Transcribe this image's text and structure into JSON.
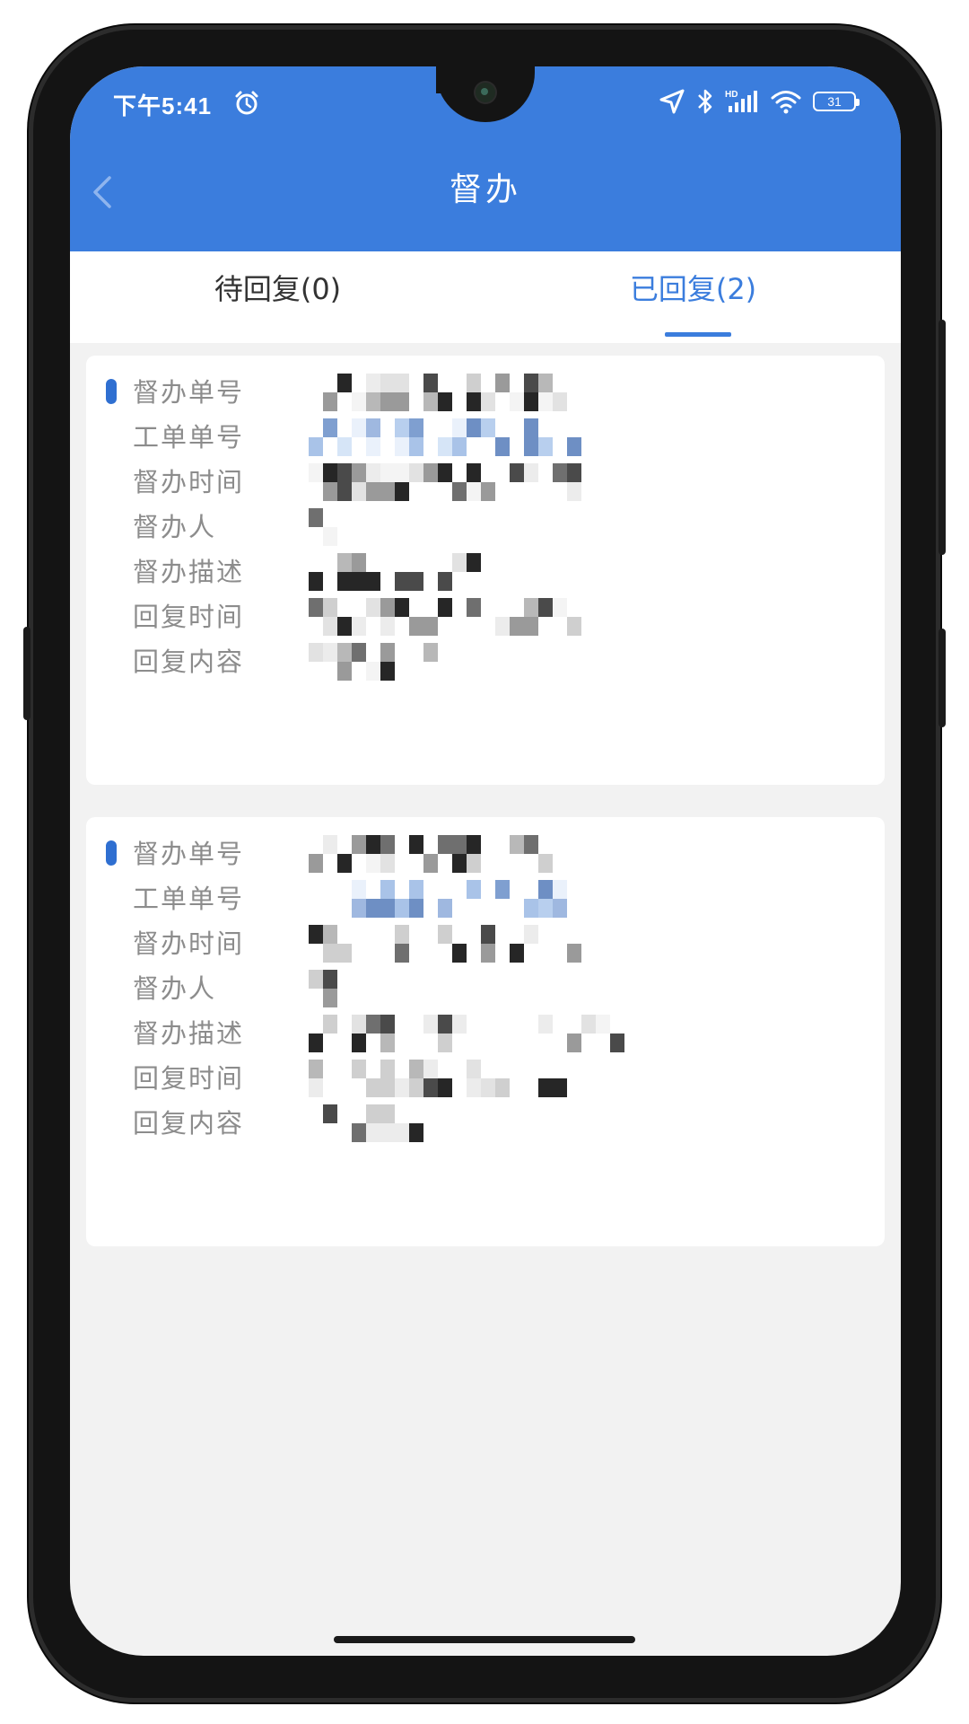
{
  "status_bar": {
    "time": "下午5:41",
    "battery": "31",
    "icons": [
      "alarm-icon",
      "location-icon",
      "bluetooth-icon",
      "hd-signal-icon",
      "wifi-icon",
      "battery-icon"
    ]
  },
  "header": {
    "title": "督办",
    "back_icon": "chevron-left-icon",
    "background": "#3b7ddd"
  },
  "tabs": [
    {
      "label": "待回复(0)",
      "active": false
    },
    {
      "label": "已回复(2)",
      "active": true
    }
  ],
  "colors": {
    "accent": "#3b7ddd",
    "label": "#8c8c8c",
    "background": "#f2f2f2"
  },
  "cards": [
    {
      "fields": [
        {
          "label": "督办单号",
          "value": "[redacted]"
        },
        {
          "label": "工单单号",
          "value": "[redacted]"
        },
        {
          "label": "督办时间",
          "value": "[redacted]"
        },
        {
          "label": "督办人",
          "value": "[redacted]"
        },
        {
          "label": "督办描述",
          "value": "[redacted]"
        },
        {
          "label": "回复时间",
          "value": "[redacted]"
        },
        {
          "label": "回复内容",
          "value": "[redacted]"
        }
      ]
    },
    {
      "fields": [
        {
          "label": "督办单号",
          "value": "[redacted]"
        },
        {
          "label": "工单单号",
          "value": "[redacted]"
        },
        {
          "label": "督办时间",
          "value": "[redacted]"
        },
        {
          "label": "督办人",
          "value": "[redacted]"
        },
        {
          "label": "督办描述",
          "value": "[redacted]"
        },
        {
          "label": "回复时间",
          "value": "[redacted]"
        },
        {
          "label": "回复内容",
          "value": "[redacted]"
        }
      ]
    }
  ]
}
